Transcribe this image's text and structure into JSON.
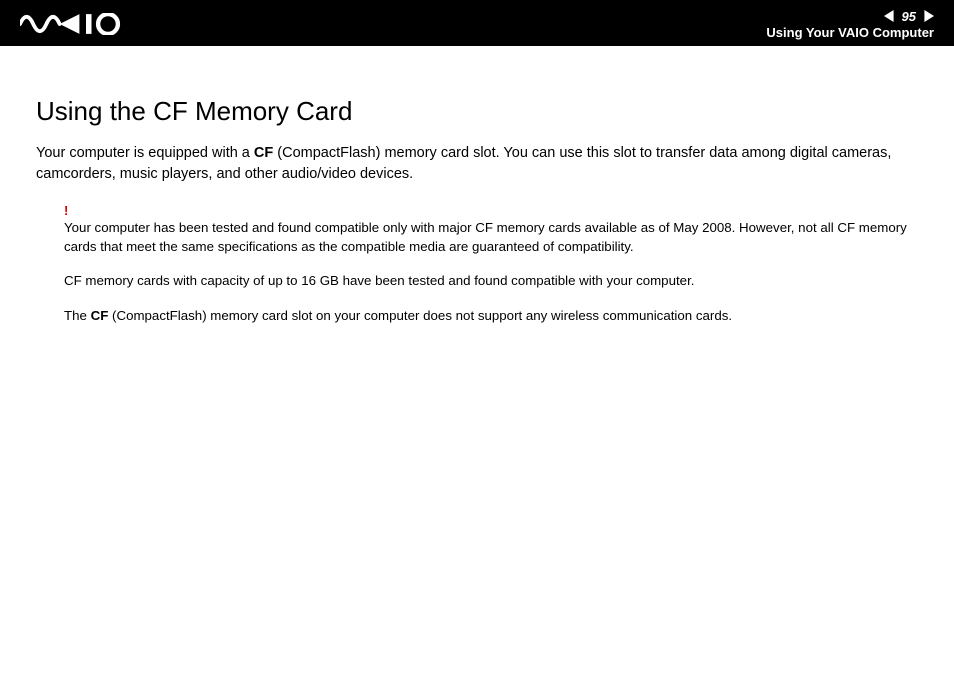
{
  "header": {
    "page_number": "95",
    "section": "Using Your VAIO Computer"
  },
  "content": {
    "title": "Using the CF Memory Card",
    "intro_pre": "Your computer is equipped with a ",
    "intro_bold": "CF",
    "intro_post": " (CompactFlash) memory card slot. You can use this slot to transfer data among digital cameras, camcorders, music players, and other audio/video devices.",
    "warn_mark": "!",
    "note1": "Your computer has been tested and found compatible only with major CF memory cards available as of May 2008. However, not all CF memory cards that meet the same specifications as the compatible media are guaranteed of compatibility.",
    "note2": "CF memory cards with capacity of up to 16 GB have been tested and found compatible with your computer.",
    "note3_pre": "The ",
    "note3_bold": "CF",
    "note3_post": " (CompactFlash) memory card slot on your computer does not support any wireless communication cards."
  }
}
